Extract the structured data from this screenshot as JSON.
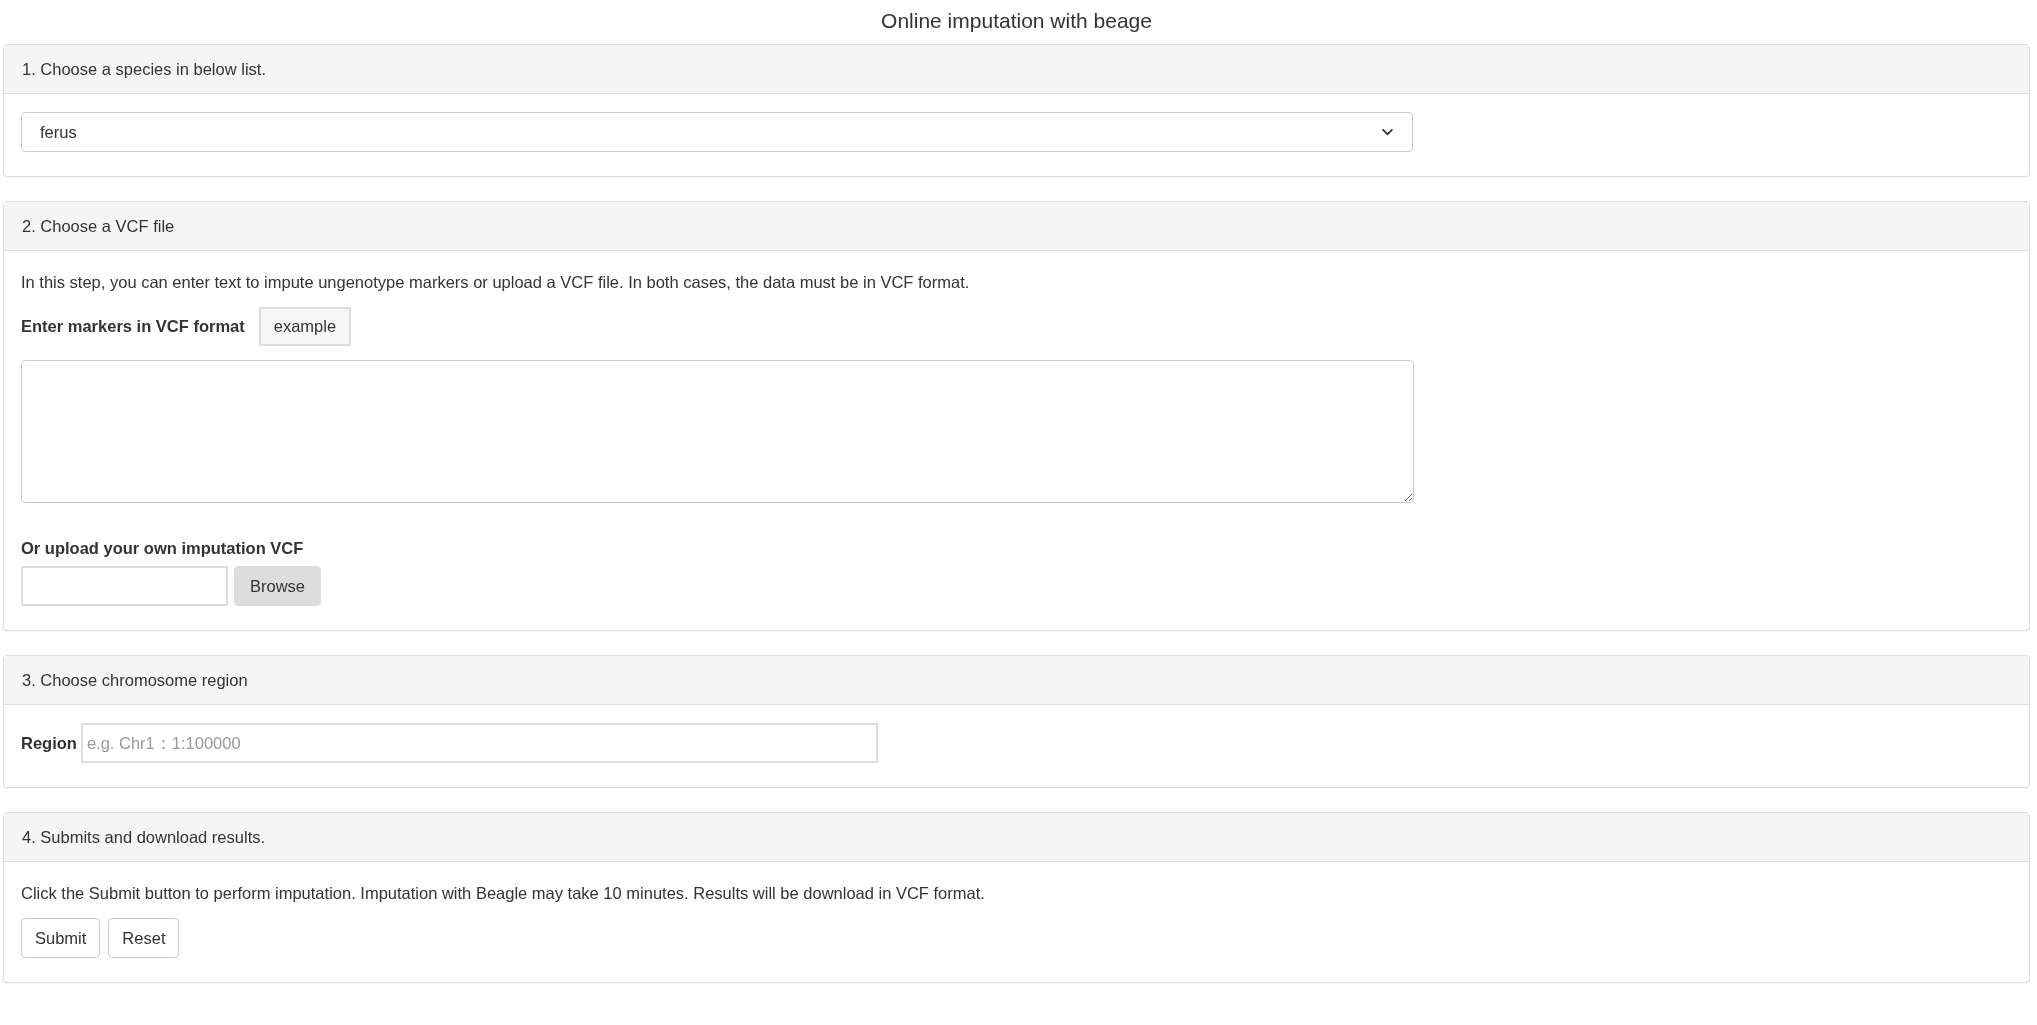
{
  "title": "Online imputation with beage",
  "panels": [
    {
      "heading": "1. Choose a species in below list.",
      "body": [
        {
          "kind": "select",
          "value": "ferus"
        }
      ]
    },
    {
      "heading": "2. Choose a VCF file",
      "body": [
        {
          "kind": "text",
          "text": "In this step, you can enter text to impute ungenotype markers or upload a VCF file. In both cases, the data must be in VCF format."
        },
        {
          "kind": "label_button",
          "label": "Enter markers in VCF format",
          "button": "example"
        },
        {
          "kind": "textarea"
        },
        {
          "kind": "label",
          "label": "Or upload your own imputation VCF"
        },
        {
          "kind": "file",
          "button": "Browse"
        }
      ]
    },
    {
      "heading": "3. Choose chromosome region",
      "body": [
        {
          "kind": "field",
          "label": "Region",
          "placeholder": "e.g. Chr1：1:100000"
        }
      ]
    },
    {
      "heading": "4. Submits and download results.",
      "body": [
        {
          "kind": "text",
          "text": "Click the Submit button to perform imputation. Imputation with Beagle may take 10 minutes. Results will be download in VCF format."
        },
        {
          "kind": "buttons",
          "buttons": [
            "Submit",
            "Reset"
          ]
        }
      ]
    }
  ]
}
